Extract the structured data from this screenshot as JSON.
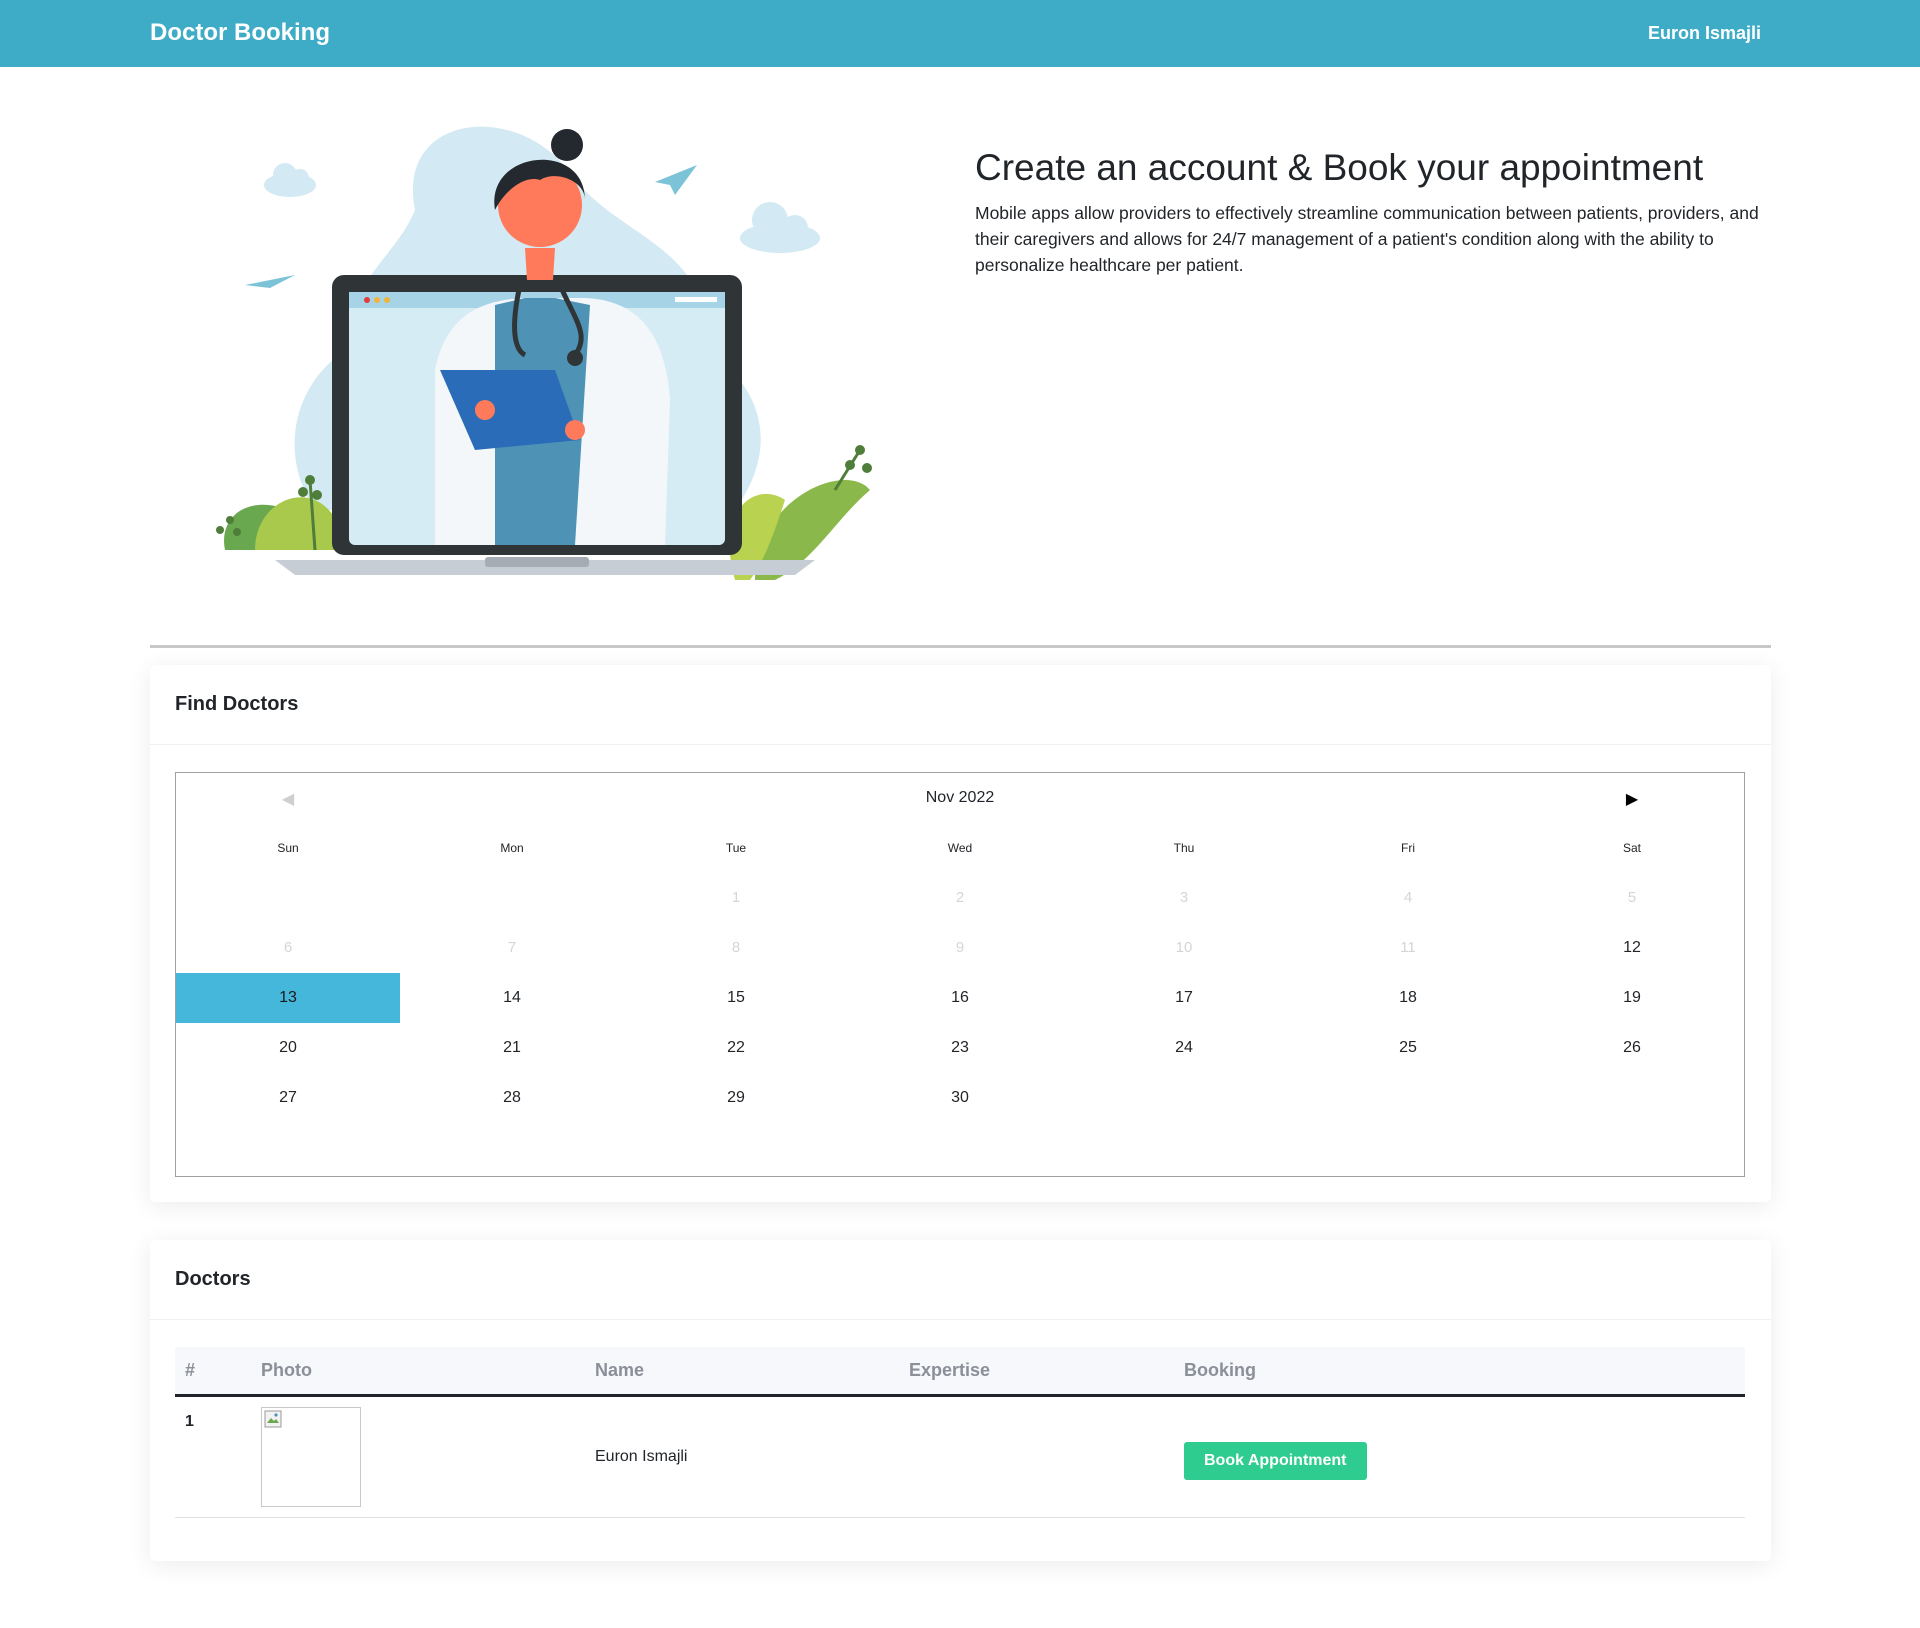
{
  "navbar": {
    "brand": "Doctor Booking",
    "user": "Euron Ismajli",
    "color": "#3eacc6"
  },
  "hero": {
    "title": "Create an account & Book your appointment",
    "text": "Mobile apps allow providers to effectively streamline communication between patients, providers, and their caregivers and allows for 24/7 management of a patient's condition along with the ability to personalize healthcare per patient.",
    "illustration": "doctor-laptop-illustration"
  },
  "find_doctors": {
    "title": "Find Doctors",
    "calendar": {
      "month_label": "Nov 2022",
      "prev_icon": "◀",
      "next_icon": "▶",
      "weekdays": [
        "Sun",
        "Mon",
        "Tue",
        "Wed",
        "Thu",
        "Fri",
        "Sat"
      ],
      "days": [
        {
          "label": "",
          "state": "empty"
        },
        {
          "label": "",
          "state": "empty"
        },
        {
          "label": "1",
          "state": "disabled"
        },
        {
          "label": "2",
          "state": "disabled"
        },
        {
          "label": "3",
          "state": "disabled"
        },
        {
          "label": "4",
          "state": "disabled"
        },
        {
          "label": "5",
          "state": "disabled"
        },
        {
          "label": "6",
          "state": "disabled"
        },
        {
          "label": "7",
          "state": "disabled"
        },
        {
          "label": "8",
          "state": "disabled"
        },
        {
          "label": "9",
          "state": "disabled"
        },
        {
          "label": "10",
          "state": "disabled"
        },
        {
          "label": "11",
          "state": "disabled"
        },
        {
          "label": "12",
          "state": "active"
        },
        {
          "label": "13",
          "state": "selected"
        },
        {
          "label": "14",
          "state": "active"
        },
        {
          "label": "15",
          "state": "active"
        },
        {
          "label": "16",
          "state": "active"
        },
        {
          "label": "17",
          "state": "active"
        },
        {
          "label": "18",
          "state": "active"
        },
        {
          "label": "19",
          "state": "active"
        },
        {
          "label": "20",
          "state": "active"
        },
        {
          "label": "21",
          "state": "active"
        },
        {
          "label": "22",
          "state": "active"
        },
        {
          "label": "23",
          "state": "active"
        },
        {
          "label": "24",
          "state": "active"
        },
        {
          "label": "25",
          "state": "active"
        },
        {
          "label": "26",
          "state": "active"
        },
        {
          "label": "27",
          "state": "active"
        },
        {
          "label": "28",
          "state": "active"
        },
        {
          "label": "29",
          "state": "active"
        },
        {
          "label": "30",
          "state": "active"
        }
      ],
      "selected_color": "#45b7db"
    }
  },
  "doctors": {
    "title": "Doctors",
    "columns": [
      "#",
      "Photo",
      "Name",
      "Expertise",
      "Booking"
    ],
    "rows": [
      {
        "num": "1",
        "photo": "broken-image-icon",
        "name": "Euron Ismajli",
        "expertise": "",
        "button": "Book Appointment"
      }
    ],
    "button_color": "#2ecc8f"
  }
}
